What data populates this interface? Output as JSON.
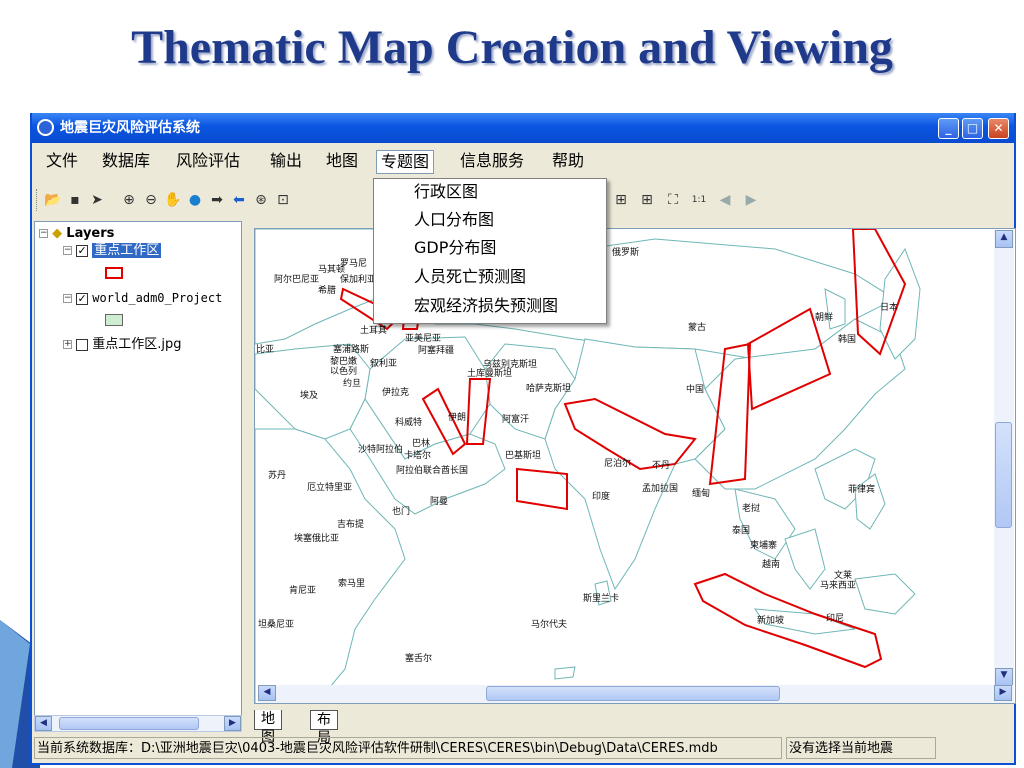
{
  "slide": {
    "title": "Thematic Map Creation and Viewing"
  },
  "window": {
    "title": "地震巨灾风险评估系统",
    "controls": {
      "minimize": "_",
      "maximize": "□",
      "close": "✕"
    }
  },
  "menubar": {
    "items": [
      "文件",
      "数据库",
      "风险评估",
      "输出",
      "地图",
      "专题图",
      "信息服务",
      "帮助"
    ],
    "active": "专题图"
  },
  "dropdown": {
    "items": [
      "行政区图",
      "人口分布图",
      "GDP分布图",
      "人员死亡预测图",
      "宏观经济损失预测图"
    ]
  },
  "toolbar": {
    "icons": [
      "open-folder-icon",
      "save-icon",
      "pointer-icon",
      "zoom-in-icon",
      "zoom-out-icon",
      "pan-hand-icon",
      "globe-full-extent-icon",
      "forward-arrow-icon",
      "back-arrow-icon",
      "fixed-zoom-in-icon",
      "identify-icon",
      "fixed-zoom-icon",
      "fixed-zoom-out-icon",
      "full-extent-icon",
      "scale-icon",
      "previous-extent-icon",
      "next-extent-icon"
    ]
  },
  "toc": {
    "root": "Layers",
    "layers": [
      {
        "name": "重点工作区",
        "checked": true,
        "symbol": "red-outline",
        "selected": true
      },
      {
        "name": "world_adm0_Project",
        "checked": true,
        "symbol": "green-fill",
        "selected": false
      },
      {
        "name": "重点工作区.jpg",
        "checked": false,
        "symbol": null,
        "selected": false
      }
    ]
  },
  "map": {
    "labels": [
      "罗马尼",
      "马其顿",
      "阿尔巴尼亚",
      "保加利亚",
      "希腊",
      "俄罗斯",
      "土耳其",
      "亚美尼亚",
      "阿塞拜疆",
      "塞浦路斯",
      "黎巴嫩",
      "叙利亚",
      "以色列",
      "约旦",
      "伊拉克",
      "埃及",
      "科威特",
      "伊朗",
      "阿富汗",
      "卡塔尔",
      "巴林",
      "沙特阿拉伯",
      "阿拉伯联合酋长国",
      "巴基斯坦",
      "阿曼",
      "也门",
      "乌兹别克斯坦",
      "土库曼斯坦",
      "哈萨克斯坦",
      "蒙古",
      "中国",
      "朝鲜",
      "韩国",
      "日本",
      "尼泊尔",
      "不丹",
      "孟加拉国",
      "印度",
      "缅甸",
      "老挝",
      "泰国",
      "柬埔寨",
      "越南",
      "菲律宾",
      "文莱",
      "马来西亚",
      "新加坡",
      "印尼",
      "斯里兰卡",
      "马尔代夫",
      "苏丹",
      "厄立特里亚",
      "吉布提",
      "埃塞俄比亚",
      "索马里",
      "肯尼亚",
      "坦桑尼亚",
      "塞舌尔",
      "比亚"
    ]
  },
  "tabs": [
    "地图",
    "布局"
  ],
  "status": {
    "db_path": "当前系统数据库：D:\\亚洲地震巨灾\\0403-地震巨灾风险评估软件研制\\CERES\\CERES\\bin\\Debug\\Data\\CERES.mdb",
    "quake": "没有选择当前地震"
  },
  "colors": {
    "title_text": "#1f3a8a",
    "titlebar": "#0a55e0",
    "work_zone_outline": "#e00000",
    "country_fill": "#ffffff",
    "country_border": "#6fb6b6"
  }
}
